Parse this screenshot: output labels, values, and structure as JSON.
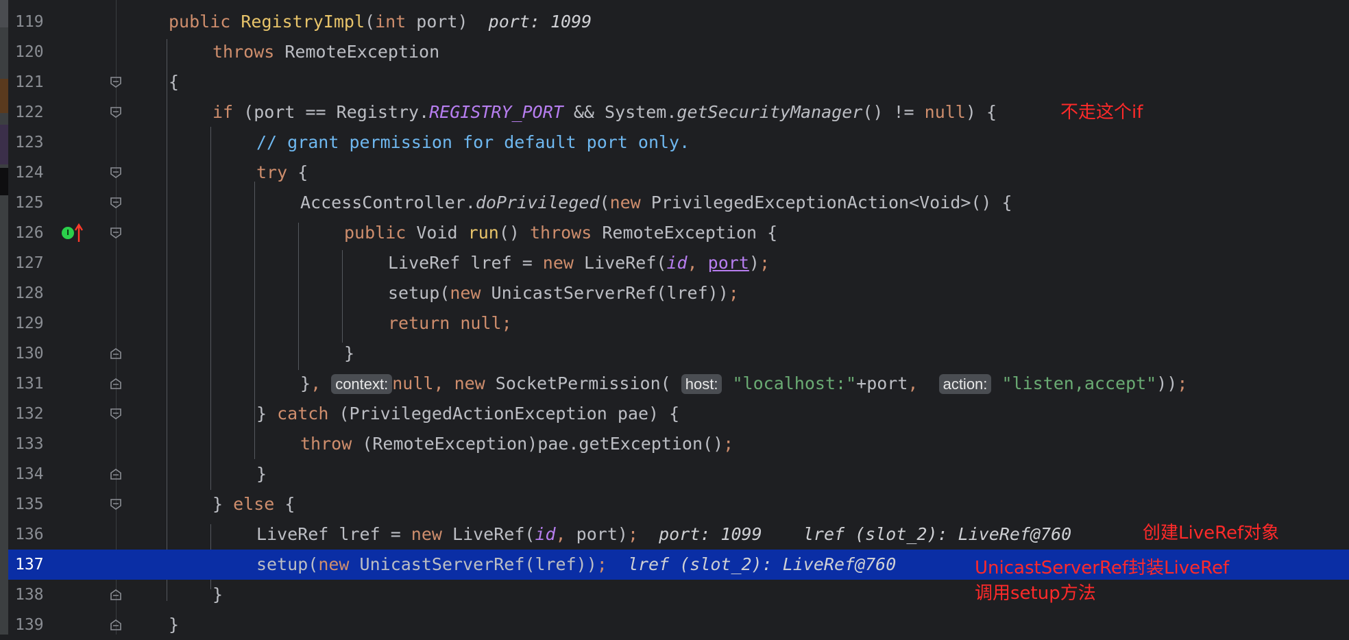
{
  "editor": {
    "line_numbers": [
      "119",
      "120",
      "121",
      "122",
      "123",
      "124",
      "125",
      "126",
      "127",
      "128",
      "129",
      "130",
      "131",
      "132",
      "133",
      "134",
      "135",
      "136",
      "137",
      "138",
      "139"
    ],
    "active_line": "137",
    "colors": {
      "background": "#1e1f22",
      "active_line": "#0a2ea5",
      "annotation": "#ff2a2a"
    },
    "gutter_icons": {
      "line_126": [
        "implementation-icon",
        "override-arrow-icon"
      ],
      "implementation_letter": "I"
    },
    "tokens": {
      "public": "public",
      "class_ctor": "RegistryImpl",
      "int": "int",
      "port": "port",
      "throws": "throws",
      "remote_exception": "RemoteException",
      "if": "if",
      "registry": "Registry.",
      "registry_port": "REGISTRY_PORT",
      "and": "&&",
      "system": "System.",
      "get_security_manager": "getSecurityManager",
      "neq": "!=",
      "null": "null",
      "comment": "// grant permission for default port only.",
      "try": "try",
      "access_controller": "AccessController.",
      "do_privileged": "doPrivileged",
      "new": "new",
      "privileged_action": "PrivilegedExceptionAction<Void>",
      "void": "Void",
      "run": "run",
      "liveref": "LiveRef",
      "lref": "lref",
      "id": "id",
      "setup": "setup",
      "unicast": "UnicastServerRef",
      "return": "return",
      "socket_permission": "SocketPermission",
      "localhost": "\"localhost:\"",
      "listen_accept": "\"listen,accept\"",
      "catch": "catch",
      "privileged_action_exception": "PrivilegedActionException",
      "pae": "pae",
      "throw": "throw",
      "get_exception": "pae.getException",
      "else": "else"
    },
    "param_hints": {
      "context": "context:",
      "host": "host:",
      "action": "action:"
    },
    "debug_values": {
      "line_119": "port: 1099",
      "line_136_port": "port: 1099",
      "line_136_lref": "lref (slot_2): LiveRef@760",
      "line_137_lref": "lref (slot_2): LiveRef@760"
    },
    "annotations": {
      "line_122": "不走这个if",
      "line_136": "创建LiveRef对象",
      "line_137_a": "UnicastServerRef封装LiveRef",
      "line_137_b": "调用setup方法"
    }
  }
}
